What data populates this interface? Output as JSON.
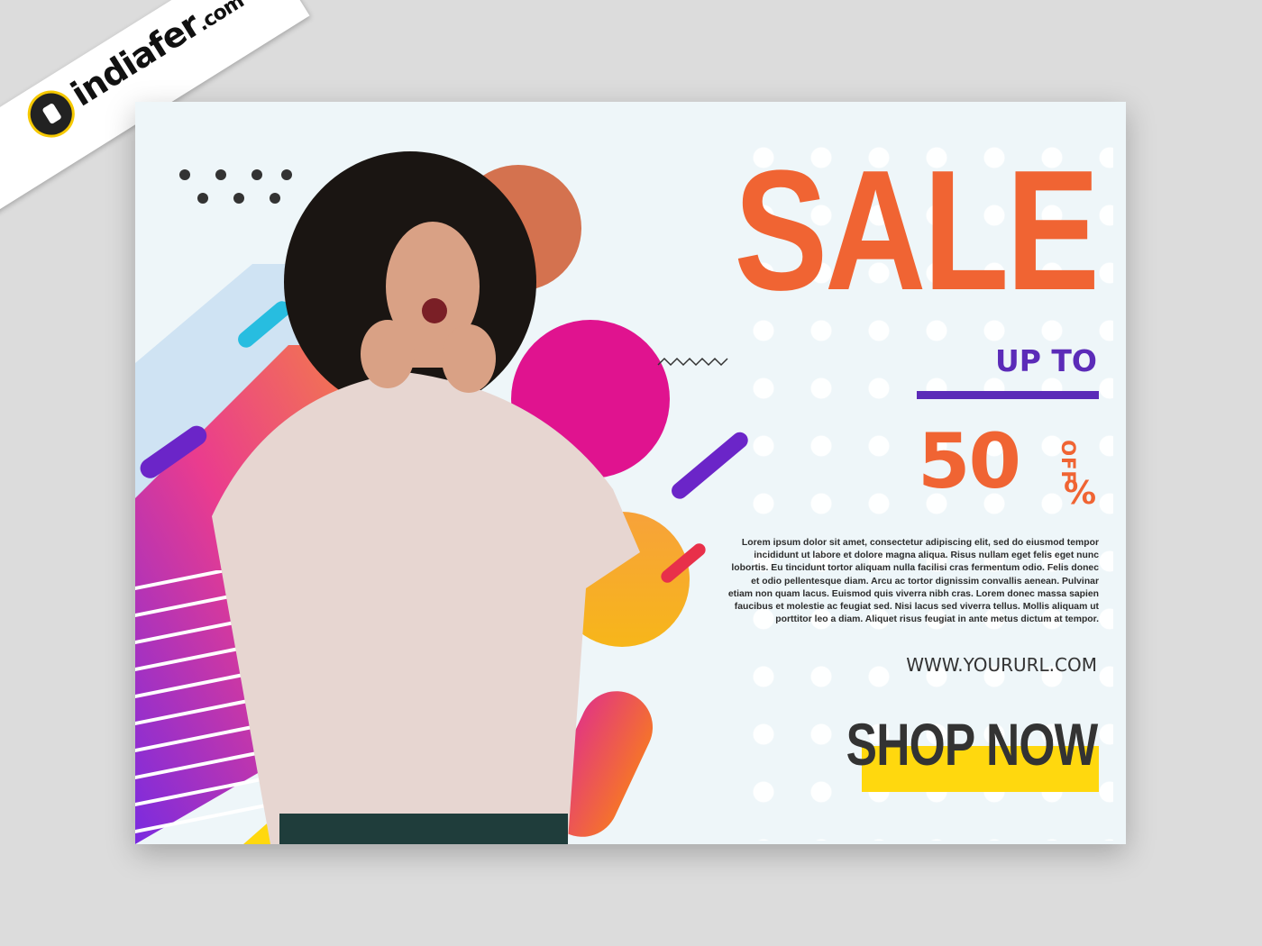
{
  "watermark": {
    "brand": "indiafer",
    "domain": ".com"
  },
  "banner": {
    "title": "SALE",
    "upto": "UP TO",
    "discount_number": "50",
    "discount_symbol": "%",
    "discount_suffix": "OFF",
    "body": "Lorem ipsum dolor sit amet, consectetur adipiscing elit, sed do eiusmod tempor incididunt ut labore et dolore magna aliqua. Risus nullam eget felis eget nunc lobortis. Eu tincidunt tortor aliquam nulla facilisi cras fermentum odio. Felis donec et odio pellentesque diam. Arcu ac tortor dignissim convallis aenean. Pulvinar etiam non quam lacus. Euismod quis viverra nibh cras. Lorem donec massa sapien faucibus et molestie ac feugiat sed. Nisi lacus sed viverra tellus. Mollis aliquam ut porttitor leo a diam. Aliquet risus feugiat in ante metus dictum at tempor.",
    "url": "WWW.YOURURL.COM",
    "cta": "SHOP NOW"
  },
  "colors": {
    "orange": "#f06433",
    "purple": "#5b2bb8",
    "magenta": "#e0138f",
    "yellow": "#ffd80e"
  }
}
